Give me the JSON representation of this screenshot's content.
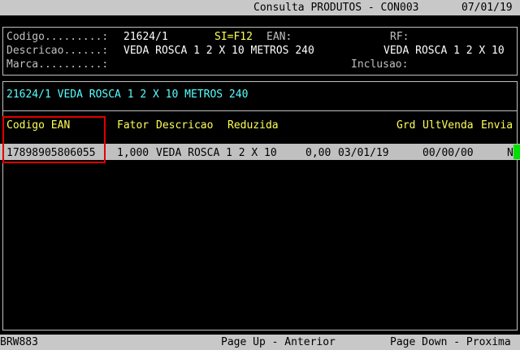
{
  "header": {
    "title": "Consulta PRODUTOS - CON003",
    "date": "07/01/19"
  },
  "product_info": {
    "codigo_label": "Codigo.........:",
    "codigo_value": "21624/1",
    "si_label": "SI=F12",
    "ean_label": "EAN:",
    "rf_label": "RF:",
    "descricao_label": "Descricao......:",
    "descricao_value": "VEDA ROSCA 1 2 X 10 METROS 240",
    "descricao_short": "VEDA ROSCA 1 2 X 10",
    "marca_label": "Marca..........:",
    "inclusao_label": "Inclusao:"
  },
  "summary_line": "21624/1 VEDA ROSCA 1 2 X 10 METROS 240",
  "table": {
    "columns": [
      "Codigo EAN",
      "Fator",
      "Descricao",
      "Reduzida",
      "Grd",
      "UltVenda",
      "Envia"
    ],
    "rows": [
      {
        "codigo_ean": "17898905806055",
        "fator": "1,000",
        "descricao": "VEDA ROSCA 1 2 X 10",
        "reduzida": "0,00",
        "date": "03/01/19",
        "ultvenda": "00/00/00",
        "envia": "N"
      }
    ]
  },
  "footer": {
    "id": "BRW883",
    "page_up": "Page Up - Anterior",
    "page_down": "Page Down - Proxima"
  },
  "colors": {
    "background": "#000000",
    "bar": "#c8c8c8",
    "label": "#c0c0c0",
    "value": "#ffffff",
    "highlight_yellow": "#ffff55",
    "cyan": "#55ffff",
    "selection_marker": "#00e000",
    "annotation_red": "#e00000"
  }
}
